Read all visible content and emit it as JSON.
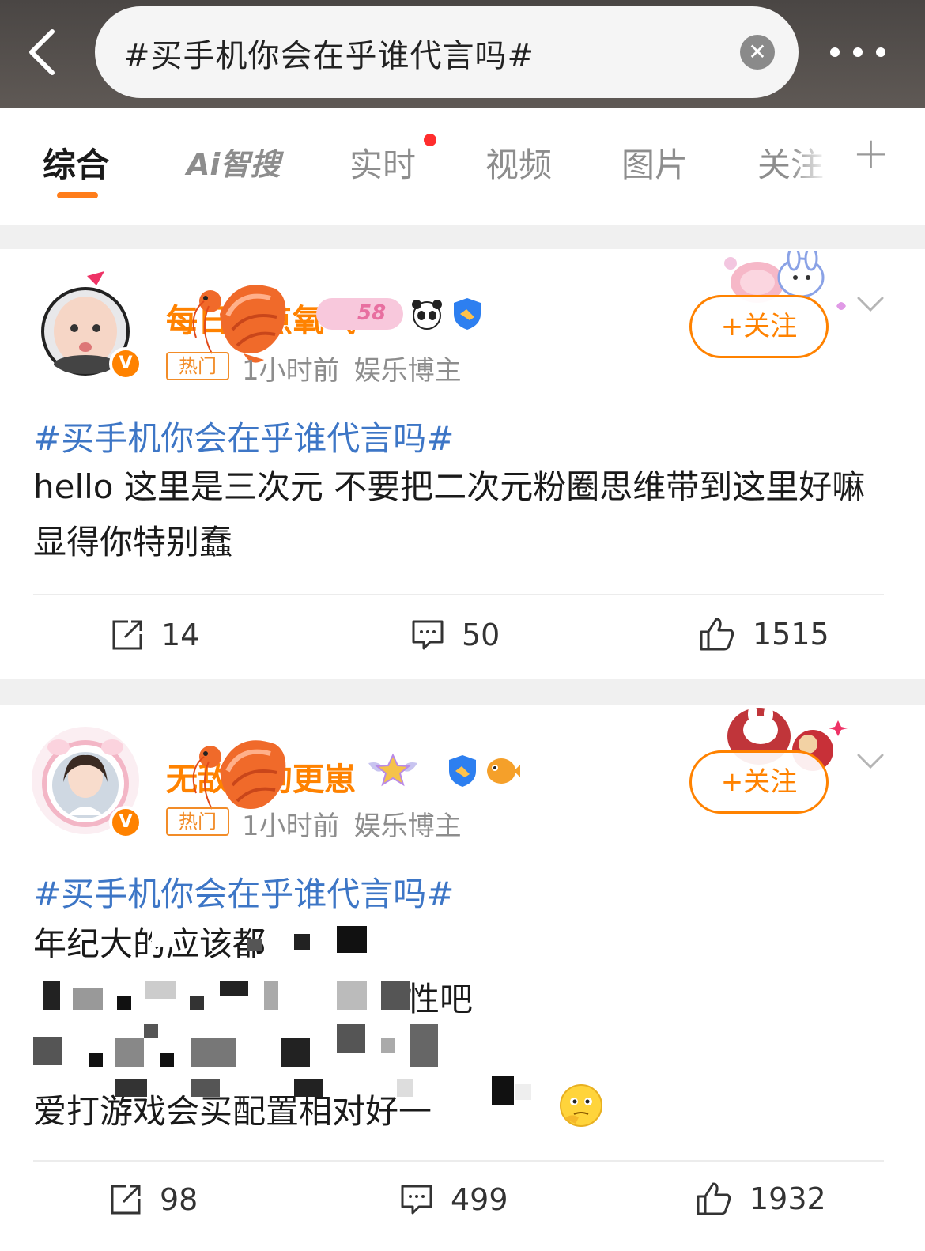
{
  "header": {
    "search_query": "#买手机你会在乎谁代言吗#",
    "clear_icon": "close-icon",
    "back_icon": "chevron-left-icon",
    "more_icon": "more-dots-icon"
  },
  "tabs": [
    {
      "label": "综合",
      "active": true
    },
    {
      "label": "Ai智搜",
      "active": false
    },
    {
      "label": "实时",
      "active": false,
      "dot": true
    },
    {
      "label": "视频",
      "active": false
    },
    {
      "label": "图片",
      "active": false
    },
    {
      "label": "关注",
      "active": false
    }
  ],
  "tab_add_label": "+",
  "accent_color": "#ff8200",
  "link_color": "#3d76c6",
  "posts": [
    {
      "username": "每日热点氧气",
      "badge_hot": "热门",
      "time": "1小时前",
      "role": "娱乐博主",
      "follow_label": "+关注",
      "topic": "#买手机你会在乎谁代言吗#",
      "text": "hello 这里是三次元 不要把二次元粉圈思维带到这里好嘛 显得你特别蠢",
      "reposts": "14",
      "comments": "50",
      "likes": "1515"
    },
    {
      "username": "无敌小狗更崽",
      "badge_hot": "热门",
      "time": "1小时前",
      "role": "娱乐博主",
      "follow_label": "+关注",
      "topic": "#买手机你会在乎谁代言吗#",
      "text_line1": "年纪大的应该都",
      "text_line2": "性吧",
      "text_line4": "爱打游戏会买配置相对好一",
      "reposts": "98",
      "comments": "499",
      "likes": "1932"
    }
  ]
}
